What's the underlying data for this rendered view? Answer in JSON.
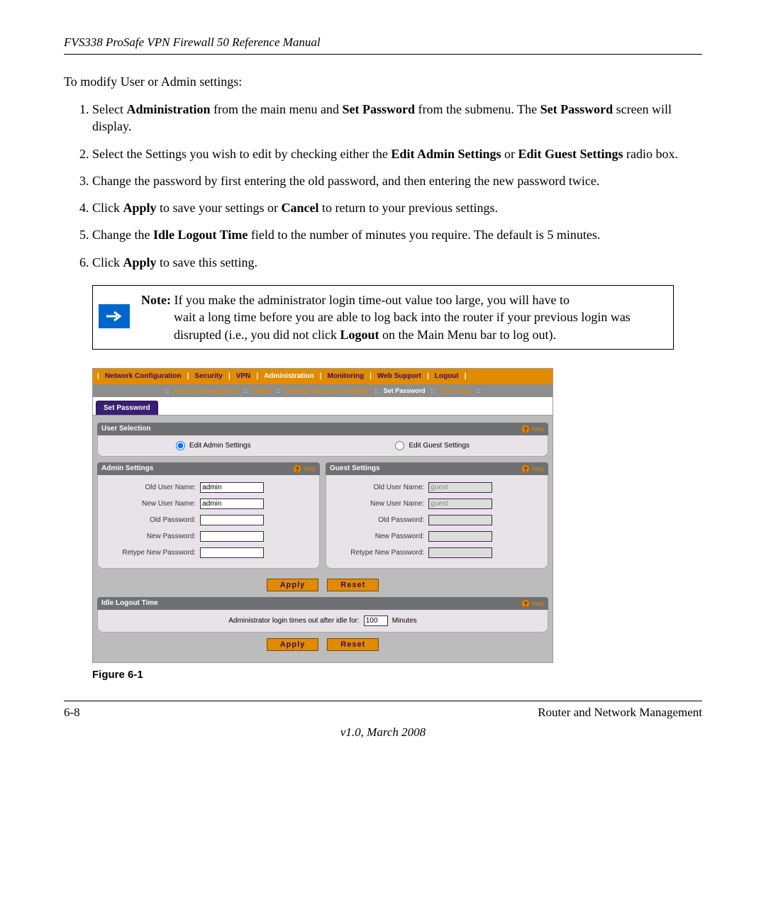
{
  "header_title": "FVS338 ProSafe VPN Firewall 50 Reference Manual",
  "intro": "To modify User or Admin settings:",
  "steps": {
    "s1a": "Select ",
    "s1b": "Administration",
    "s1c": " from the main menu and ",
    "s1d": "Set Password",
    "s1e": " from the submenu. The ",
    "s1f": "Set Password",
    "s1g": " screen will display.",
    "s2a": "Select the Settings you wish to edit by checking either the ",
    "s2b": "Edit Admin Settings",
    "s2c": " or ",
    "s2d": "Edit Guest Settings",
    "s2e": " radio box.",
    "s3": "Change the password by first entering the old password, and then entering the new password twice.",
    "s4a": "Click ",
    "s4b": "Apply",
    "s4c": " to save your settings or ",
    "s4d": "Cancel",
    "s4e": " to return to your previous settings.",
    "s5a": "Change the ",
    "s5b": "Idle Logout Time",
    "s5c": " field to the number of minutes you require. The default is 5 minutes.",
    "s6a": "Click ",
    "s6b": "Apply",
    "s6c": " to save this setting."
  },
  "note": {
    "label": "Note:",
    "line1": " If you make the administrator login time-out value too large, you will have to",
    "line2": "wait a long time before you are able to log back into the router if your previous login was disrupted (i.e., you did not click ",
    "logout_bold": "Logout",
    "line3": " on the Main Menu bar to log out)."
  },
  "ui": {
    "main_menu": [
      "Network Configuration",
      "Security",
      "VPN",
      "Administration",
      "Monitoring",
      "Web Support",
      "Logout"
    ],
    "sub_menu": [
      "Remote Management",
      "SNMP",
      "Settings Backup & Upgrade",
      "Set Password",
      "Time Zone"
    ],
    "tab": "Set Password",
    "help": "help",
    "user_selection_title": "User Selection",
    "edit_admin": "Edit Admin Settings",
    "edit_guest": "Edit Guest Settings",
    "admin_settings_title": "Admin Settings",
    "guest_settings_title": "Guest Settings",
    "labels": {
      "old_user": "Old User Name:",
      "new_user": "New User Name:",
      "old_pw": "Old Password:",
      "new_pw": "New Password:",
      "retype_pw": "Retype New Password:"
    },
    "admin_values": {
      "old_user": "admin",
      "new_user": "admin"
    },
    "guest_values": {
      "old_user": "guest",
      "new_user": "guest"
    },
    "apply_btn": "Apply",
    "reset_btn": "Reset",
    "idle_title": "Idle Logout Time",
    "idle_text": "Administrator login times out after idle for:",
    "idle_value": "100",
    "idle_unit": "Minutes"
  },
  "figure_label": "Figure 6-1",
  "footer": {
    "page": "6-8",
    "section": "Router and Network Management",
    "version": "v1.0, March 2008"
  }
}
